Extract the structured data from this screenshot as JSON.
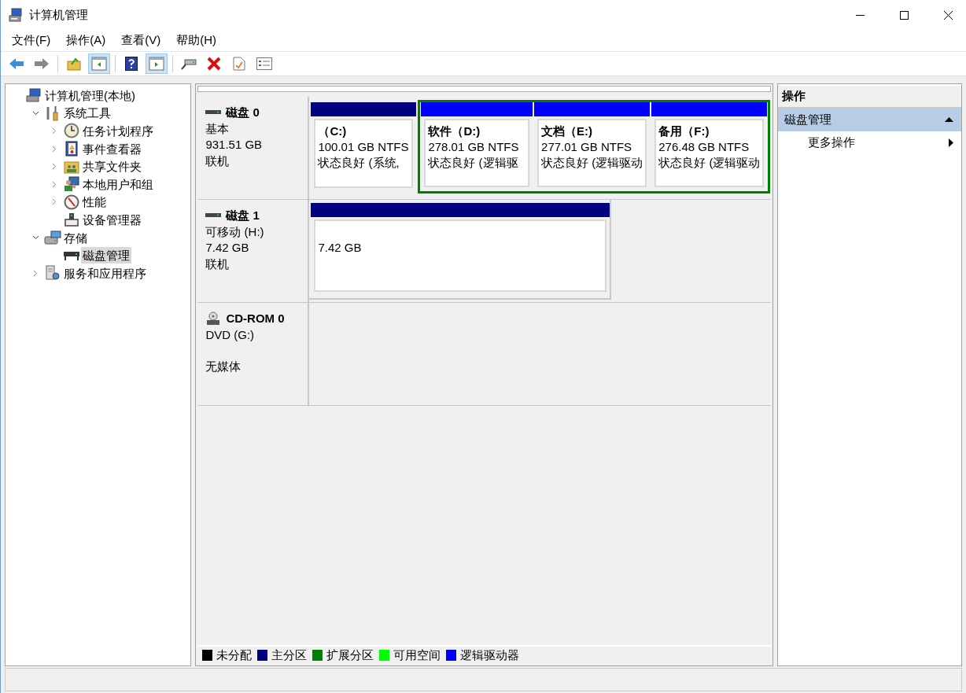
{
  "window": {
    "title": "计算机管理"
  },
  "menu": [
    {
      "label": "文件(F)"
    },
    {
      "label": "操作(A)"
    },
    {
      "label": "查看(V)"
    },
    {
      "label": "帮助(H)"
    }
  ],
  "toolbar": [
    {
      "pressed": false
    },
    {
      "pressed": false
    },
    {
      "pressed": false
    },
    {
      "pressed": true
    },
    {
      "pressed": false
    },
    {
      "pressed": true
    },
    {
      "pressed": false
    },
    {
      "pressed": false
    },
    {
      "pressed": false
    },
    {
      "pressed": false
    }
  ],
  "tree": [
    {
      "label": "计算机管理(本地)",
      "selected": false,
      "children": [
        {
          "label": "系统工具",
          "expanded": true,
          "selected": false,
          "children": [
            {
              "label": "任务计划程序",
              "expanded": false,
              "selected": false
            },
            {
              "label": "事件查看器",
              "expanded": false,
              "selected": false
            },
            {
              "label": "共享文件夹",
              "expanded": false,
              "selected": false
            },
            {
              "label": "本地用户和组",
              "expanded": false,
              "selected": false
            },
            {
              "label": "性能",
              "expanded": false,
              "selected": false
            },
            {
              "label": "设备管理器",
              "selected": false
            }
          ]
        },
        {
          "label": "存储",
          "expanded": true,
          "selected": false,
          "children": [
            {
              "label": "磁盘管理",
              "selected": true
            }
          ]
        },
        {
          "label": "服务和应用程序",
          "expanded": false,
          "selected": false
        }
      ]
    }
  ],
  "disks": [
    {
      "kind": "disk",
      "name": "磁盘 0",
      "info": [
        "基本",
        "931.51 GB"
      ],
      "status": "联机",
      "partitions": [
        {
          "kind": "primary",
          "color": "#000080",
          "title": "（C:)",
          "size": "100.01 GB NTFS",
          "state": "状态良好 (系统,"
        },
        {
          "kind": "extended",
          "color": "#008000",
          "children": [
            {
              "kind": "logical",
              "color": "#0000ff",
              "title": "软件（D:)",
              "size": "278.01 GB NTFS",
              "state": "状态良好 (逻辑驱"
            },
            {
              "kind": "logical",
              "color": "#0000ff",
              "title": "文档（E:)",
              "size": "277.01 GB NTFS",
              "state": "状态良好 (逻辑驱动"
            },
            {
              "kind": "logical",
              "color": "#0000ff",
              "title": "备用（F:)",
              "size": "276.48 GB NTFS",
              "state": "状态良好 (逻辑驱动"
            }
          ]
        }
      ]
    },
    {
      "kind": "disk",
      "name": "磁盘 1",
      "info": [
        "可移动 (H:)",
        "7.42 GB"
      ],
      "status": "联机",
      "partitions": [
        {
          "kind": "primary",
          "color": "#000080",
          "size": "7.42 GB"
        }
      ]
    },
    {
      "kind": "cdrom",
      "name": "CD-ROM 0",
      "info": [
        "DVD (G:)"
      ],
      "status": "无媒体"
    }
  ],
  "legend": [
    {
      "label": "未分配",
      "color": "#000000"
    },
    {
      "label": "主分区",
      "color": "#000080"
    },
    {
      "label": "扩展分区",
      "color": "#008000"
    },
    {
      "label": "可用空间",
      "color": "#00ff00"
    },
    {
      "label": "逻辑驱动器",
      "color": "#0000ff"
    }
  ],
  "actions": {
    "header": "操作",
    "section": {
      "label": "磁盘管理",
      "expanded": true
    },
    "items": [
      {
        "label": "更多操作"
      }
    ]
  }
}
